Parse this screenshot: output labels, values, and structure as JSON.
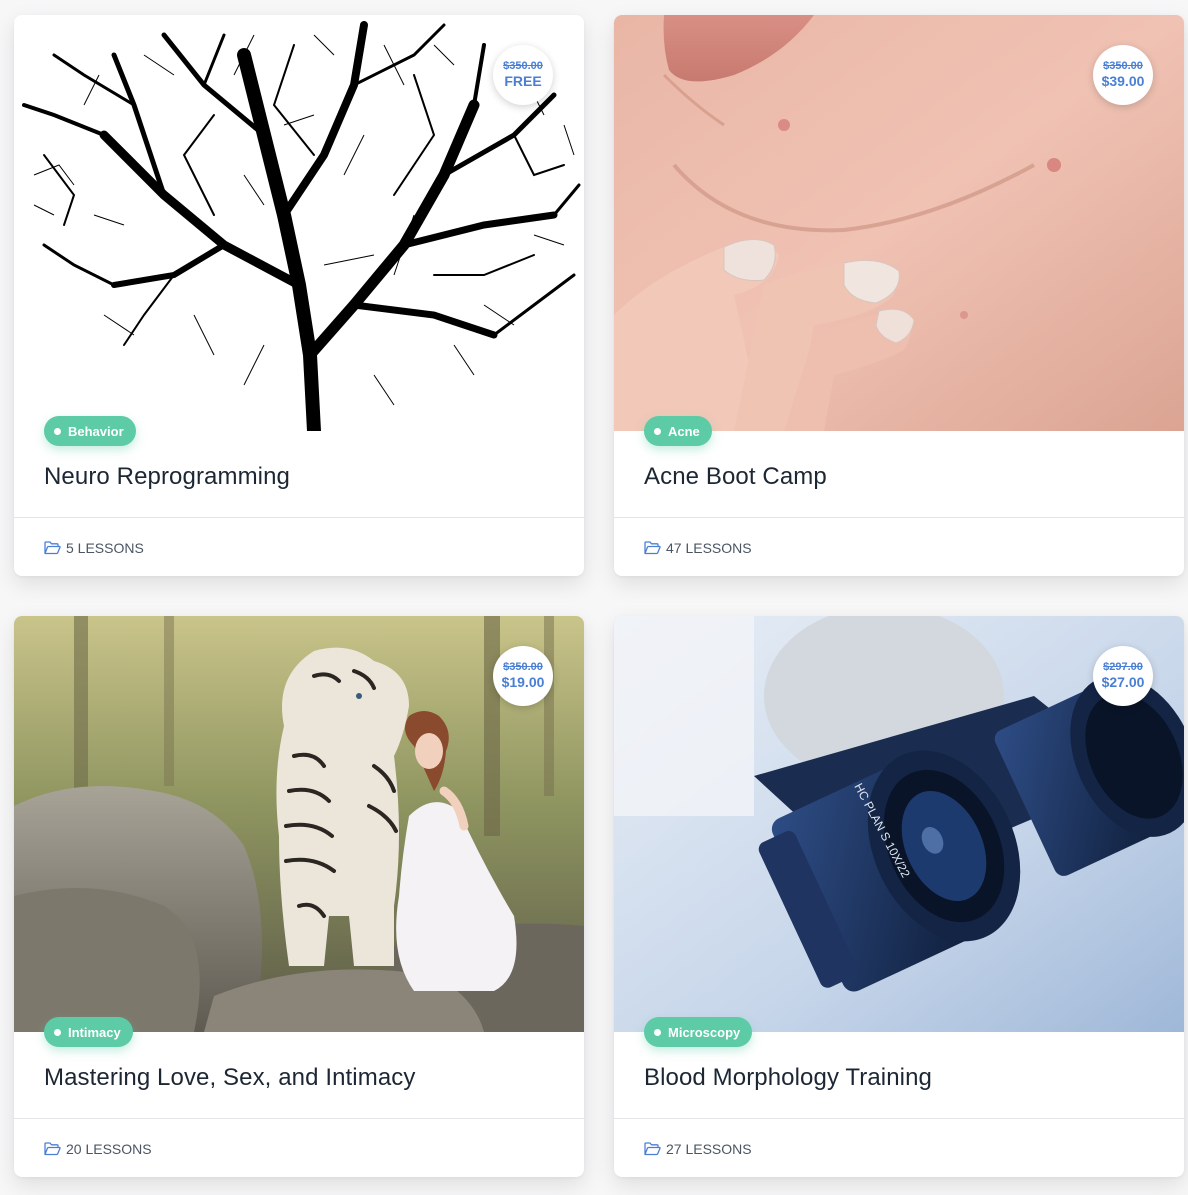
{
  "courses": [
    {
      "title": "Neuro Reprogramming",
      "category": "Behavior",
      "price_old": "$350.00",
      "price_new": "FREE",
      "lessons": "5 LESSONS",
      "image": "tree-brain-silhouette"
    },
    {
      "title": "Acne Boot Camp",
      "category": "Acne",
      "price_old": "$350.00",
      "price_new": "$39.00",
      "lessons": "47 LESSONS",
      "image": "chin-skin-closeup"
    },
    {
      "title": "Mastering Love, Sex, and Intimacy",
      "category": "Intimacy",
      "price_old": "$350.00",
      "price_new": "$19.00",
      "lessons": "20 LESSONS",
      "image": "woman-with-white-tiger"
    },
    {
      "title": "Blood Morphology Training",
      "category": "Microscopy",
      "price_old": "$297.00",
      "price_new": "$27.00",
      "lessons": "27 LESSONS",
      "image": "microscope-eyepieces"
    }
  ],
  "colors": {
    "accent_blue": "#4a7fd4",
    "tag_green": "#5ccba6",
    "title_text": "#1d2733",
    "meta_text": "#4b5563"
  },
  "icons": {
    "lessons": "folder-open-icon"
  }
}
